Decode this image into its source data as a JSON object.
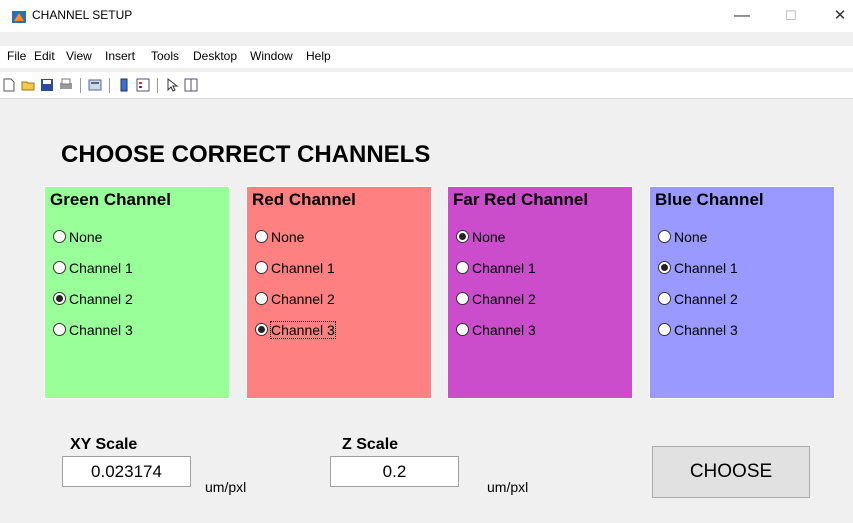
{
  "window": {
    "title": "CHANNEL SETUP",
    "controls": {
      "minimize": "—",
      "maximize": "☐",
      "close": "✕"
    }
  },
  "menu": [
    "File",
    "Edit",
    "View",
    "Insert",
    "Tools",
    "Desktop",
    "Window",
    "Help"
  ],
  "toolbar_icons": [
    "new-file-icon",
    "open-folder-icon",
    "save-icon",
    "print-icon",
    "print-preview-icon",
    "colorbar-icon",
    "legend-icon",
    "pointer-icon",
    "property-inspector-icon"
  ],
  "heading": "CHOOSE CORRECT CHANNELS",
  "panels": [
    {
      "title": "Green Channel",
      "bg": "#99ff99",
      "options": [
        "None",
        "Channel 1",
        "Channel 2",
        "Channel 3"
      ],
      "selected": "Channel 2"
    },
    {
      "title": "Red Channel",
      "bg": "#ff8080",
      "options": [
        "None",
        "Channel 1",
        "Channel 2",
        "Channel 3"
      ],
      "selected": "Channel 3"
    },
    {
      "title": "Far Red Channel",
      "bg": "#cc4dcc",
      "options": [
        "None",
        "Channel 1",
        "Channel 2",
        "Channel 3"
      ],
      "selected": "None"
    },
    {
      "title": "Blue Channel",
      "bg": "#9999ff",
      "options": [
        "None",
        "Channel 1",
        "Channel 2",
        "Channel 3"
      ],
      "selected": "Channel 1"
    }
  ],
  "xy_scale": {
    "label": "XY Scale",
    "value": "0.023174",
    "unit": "um/pxl"
  },
  "z_scale": {
    "label": "Z Scale",
    "value": "0.2",
    "unit": "um/pxl"
  },
  "choose_button": "CHOOSE"
}
